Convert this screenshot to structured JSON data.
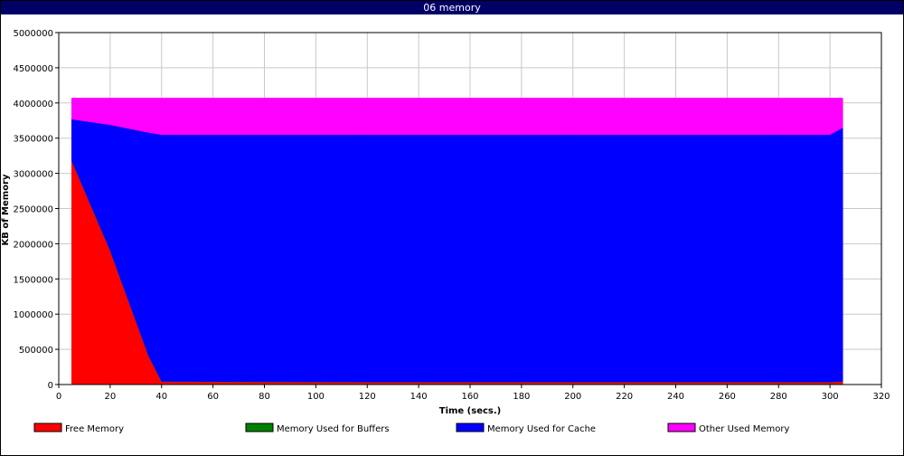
{
  "window": {
    "title": "06 memory"
  },
  "chart_data": {
    "type": "area",
    "stacked": true,
    "title": "06 memory",
    "xlabel": "Time (secs.)",
    "ylabel": "KB of Memory",
    "xlim": [
      0,
      320
    ],
    "ylim": [
      0,
      5000000
    ],
    "x_ticks": [
      0,
      20,
      40,
      60,
      80,
      100,
      120,
      140,
      160,
      180,
      200,
      220,
      240,
      260,
      280,
      300,
      320
    ],
    "y_ticks": [
      0,
      500000,
      1000000,
      1500000,
      2000000,
      2500000,
      3000000,
      3500000,
      4000000,
      4500000,
      5000000
    ],
    "grid": true,
    "legend": "bottom",
    "x": [
      5,
      20,
      35,
      40,
      80,
      120,
      160,
      200,
      240,
      280,
      300,
      305
    ],
    "series": [
      {
        "name": "Free Memory",
        "color": "#ff0000",
        "values": [
          3180000,
          1900000,
          400000,
          40000,
          35000,
          32000,
          32000,
          32000,
          32000,
          32000,
          32000,
          40000
        ]
      },
      {
        "name": "Memory Used for Buffers",
        "color": "#008000",
        "values": [
          5000,
          5000,
          5000,
          5000,
          5000,
          5000,
          5000,
          5000,
          5000,
          5000,
          5000,
          5000
        ]
      },
      {
        "name": "Memory Used for Cache",
        "color": "#0000ff",
        "values": [
          585000,
          1785000,
          3175000,
          3505000,
          3510000,
          3513000,
          3513000,
          3513000,
          3513000,
          3513000,
          3513000,
          3605000
        ]
      },
      {
        "name": "Other Used Memory",
        "color": "#ff00ff",
        "values": [
          300000,
          380000,
          490000,
          520000,
          520000,
          520000,
          520000,
          520000,
          520000,
          520000,
          520000,
          420000
        ]
      }
    ]
  }
}
